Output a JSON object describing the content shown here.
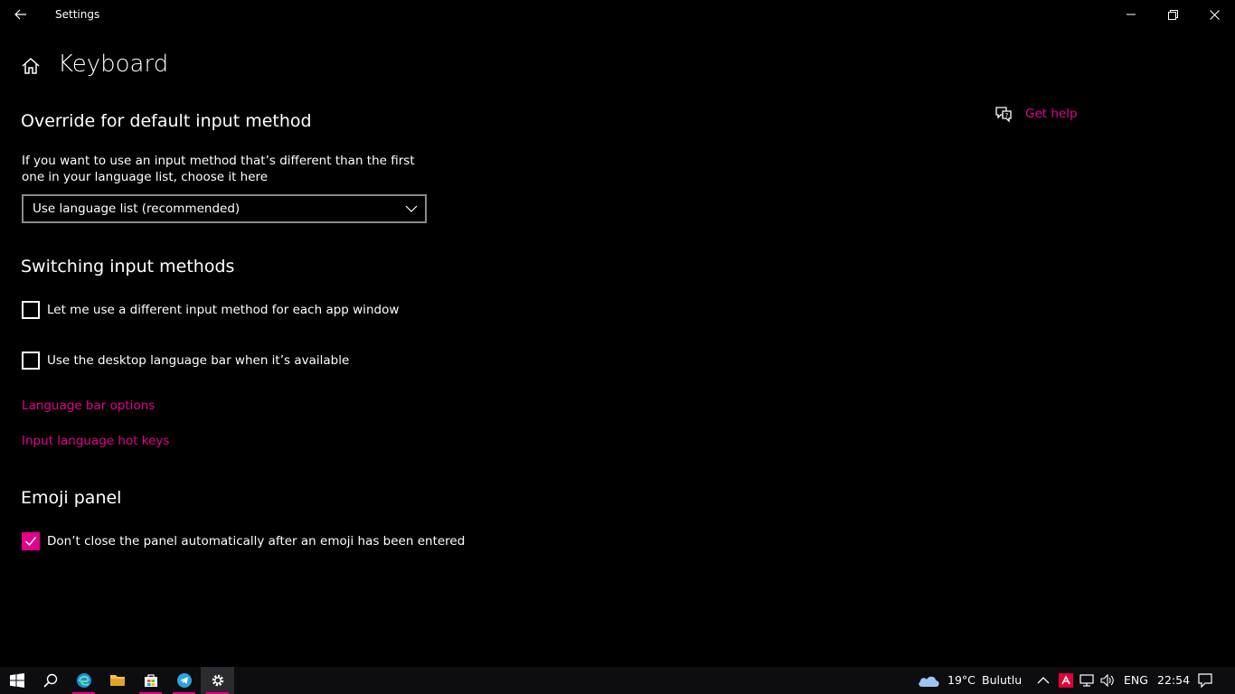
{
  "window": {
    "title": "Settings"
  },
  "header": {
    "title": "Keyboard"
  },
  "sections": {
    "override": {
      "title": "Override for default input method",
      "description": "If you want to use an input method that’s different than the first one in your language list, choose it here",
      "dropdown_value": "Use language list (recommended)"
    },
    "switching": {
      "title": "Switching input methods",
      "checkbox1_label": "Let me use a different input method for each app window",
      "checkbox1_checked": false,
      "checkbox2_label": "Use the desktop language bar when it’s available",
      "checkbox2_checked": false,
      "link1": "Language bar options",
      "link2": "Input language hot keys"
    },
    "emoji": {
      "title": "Emoji panel",
      "checkbox_label": "Don’t close the panel automatically after an emoji has been entered",
      "checkbox_checked": true
    }
  },
  "help": {
    "label": "Get help"
  },
  "taskbar": {
    "weather_temp": "19°C",
    "weather_desc": "Bulutlu",
    "language": "ENG",
    "time": "22:54"
  },
  "colors": {
    "accent": "#e3008c",
    "background": "#000000",
    "text": "#ffffff"
  }
}
